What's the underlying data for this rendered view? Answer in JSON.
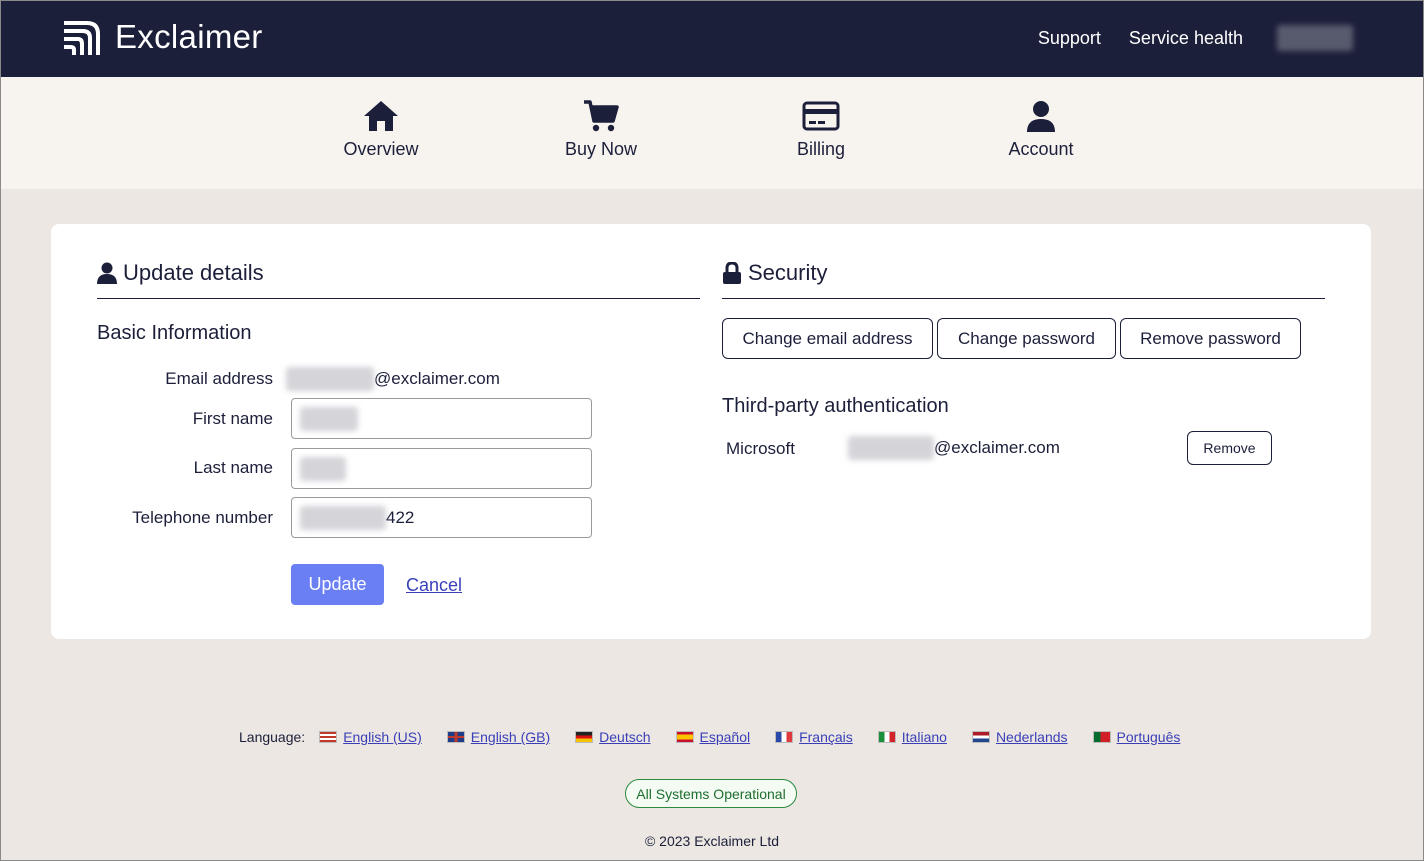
{
  "header": {
    "brand": "Exclaimer",
    "links": [
      "Support",
      "Service health"
    ]
  },
  "nav": {
    "items": [
      {
        "label": "Overview",
        "icon": "home-icon"
      },
      {
        "label": "Buy Now",
        "icon": "cart-icon"
      },
      {
        "label": "Billing",
        "icon": "credit-card-icon"
      },
      {
        "label": "Account",
        "icon": "user-icon"
      }
    ]
  },
  "update_details": {
    "title": "Update details",
    "subtitle": "Basic Information",
    "email_label": "Email address",
    "email_suffix": "@exclaimer.com",
    "first_name_label": "First name",
    "last_name_label": "Last name",
    "telephone_label": "Telephone number",
    "telephone_suffix": "422",
    "update_button": "Update",
    "cancel_link": "Cancel"
  },
  "security": {
    "title": "Security",
    "buttons": [
      "Change email address",
      "Change password",
      "Remove password"
    ],
    "third_party_title": "Third-party authentication",
    "provider": "Microsoft",
    "provider_email_suffix": "@exclaimer.com",
    "remove_button": "Remove"
  },
  "footer": {
    "language_label": "Language:",
    "languages": [
      "English (US)",
      "English (GB)",
      "Deutsch",
      "Español",
      "Français",
      "Italiano",
      "Nederlands",
      "Português"
    ],
    "status": "All Systems Operational",
    "copyright": "© 2023 Exclaimer Ltd"
  },
  "colors": {
    "header_bg": "#1c1f3a",
    "nav_bg": "#f7f3ef",
    "page_bg": "#ece7e2",
    "primary": "#6b7ff5",
    "link": "#3a3fb8",
    "status_green": "#2c8a3e"
  }
}
